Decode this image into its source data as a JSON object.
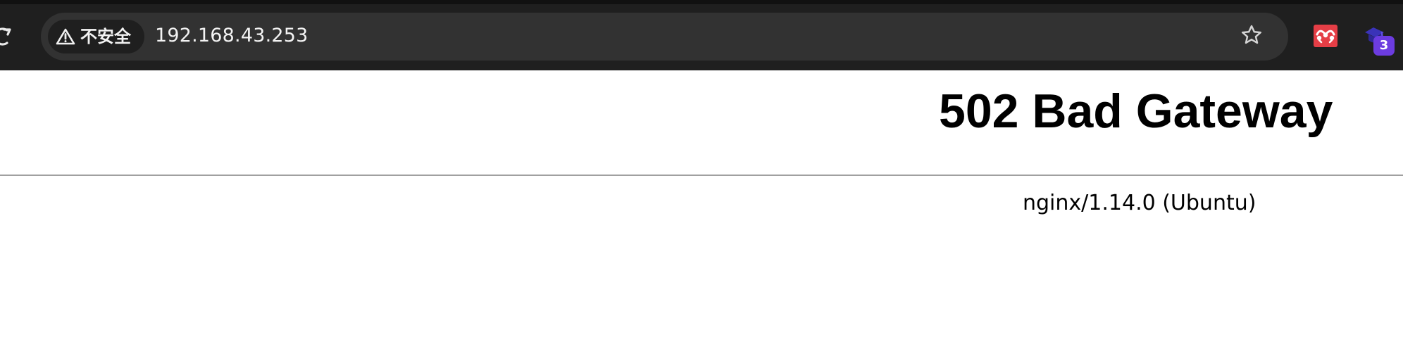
{
  "browser": {
    "address_bar": {
      "security_label": "不安全",
      "url": "192.168.43.253"
    },
    "toolbar": {
      "reload_icon": "reload-icon",
      "bookmark_icon": "star-icon",
      "extensions": [
        {
          "icon": "mendeley-extension-icon",
          "color": "#e53e46"
        },
        {
          "icon": "graduation-cap-extension-icon",
          "badge": "3",
          "badge_color": "#6c3ce0"
        }
      ]
    }
  },
  "page": {
    "title": "502 Bad Gateway",
    "server": "nginx/1.14.0 (Ubuntu)"
  }
}
